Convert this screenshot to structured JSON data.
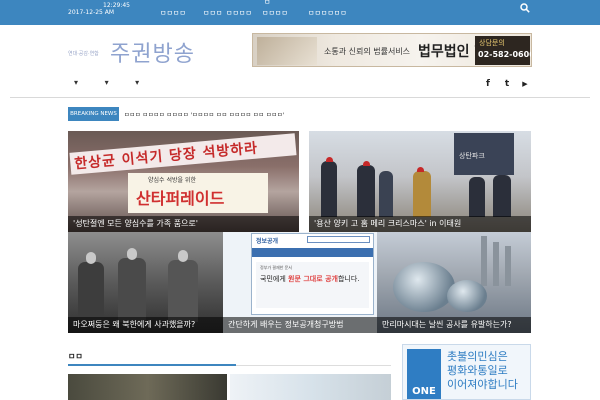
{
  "topbar": {
    "time": "12:29:45",
    "date": "2017-12-25  AM",
    "nav": [
      "ㅁㅁㅁㅁ",
      "ㅁㅁㅁ",
      "ㅁㅁㅁㅁ",
      "ㅁㅁㅁㅁ",
      "ㅁ",
      "ㅁㅁㅁㅁㅁㅁ"
    ]
  },
  "header": {
    "logo_sub": "연대·공감·연합",
    "logo_main": "주권방송",
    "ad": {
      "tagline": "소통과 신뢰의 법률서비스",
      "brand": "법무법인 향 법",
      "consult": "상담문의",
      "phone": "02-582-0606"
    }
  },
  "nav": {
    "items": [
      "▾",
      "▾",
      "▾"
    ]
  },
  "social": {
    "facebook": "f",
    "twitter": "t",
    "youtube": "▶"
  },
  "breaking": {
    "label": "BREAKING NEWS",
    "text": "ㅁㅁㅁ ㅁㅁㅁㅁ ㅁㅁㅁㅁ 'ㅁㅁㅁㅁ ㅁㅁ ㅁㅁㅁㅁ ㅁㅁ ㅁㅁㅁ'"
  },
  "tiles": [
    {
      "caption": "'성탄절엔 모든 양심수를 가족 품으로'",
      "banner_top": "한상균 이석기 당장 석방하라",
      "banner_sub": "양심수 석방을 위한",
      "banner_main": "산타퍼레이드"
    },
    {
      "caption": "'용산 양키 고 홈 메리 크리스마스' in 이태원",
      "store": "상탄파크"
    },
    {
      "caption": "마오쩌둥은 왜 북한에게 사과했을까?"
    },
    {
      "caption": "간단하게 배우는 정보공개청구방법",
      "site": "정보공개",
      "pane_small": "정부가 결재한 문서",
      "pane_main_a": "국민에게 ",
      "pane_main_b": "원문 그대로 공개",
      "pane_main_c": "합니다."
    },
    {
      "caption": "만리마시대는 날씬 공사를 유발하는가?"
    }
  ],
  "section": {
    "title": "ㅁㅁ"
  },
  "side_banner": {
    "badge": "ONE",
    "line1": "촛불의민심은",
    "line2": "평화와통일로",
    "line3": "이어져야합니다"
  },
  "colors": {
    "accent": "#3d86bf"
  }
}
